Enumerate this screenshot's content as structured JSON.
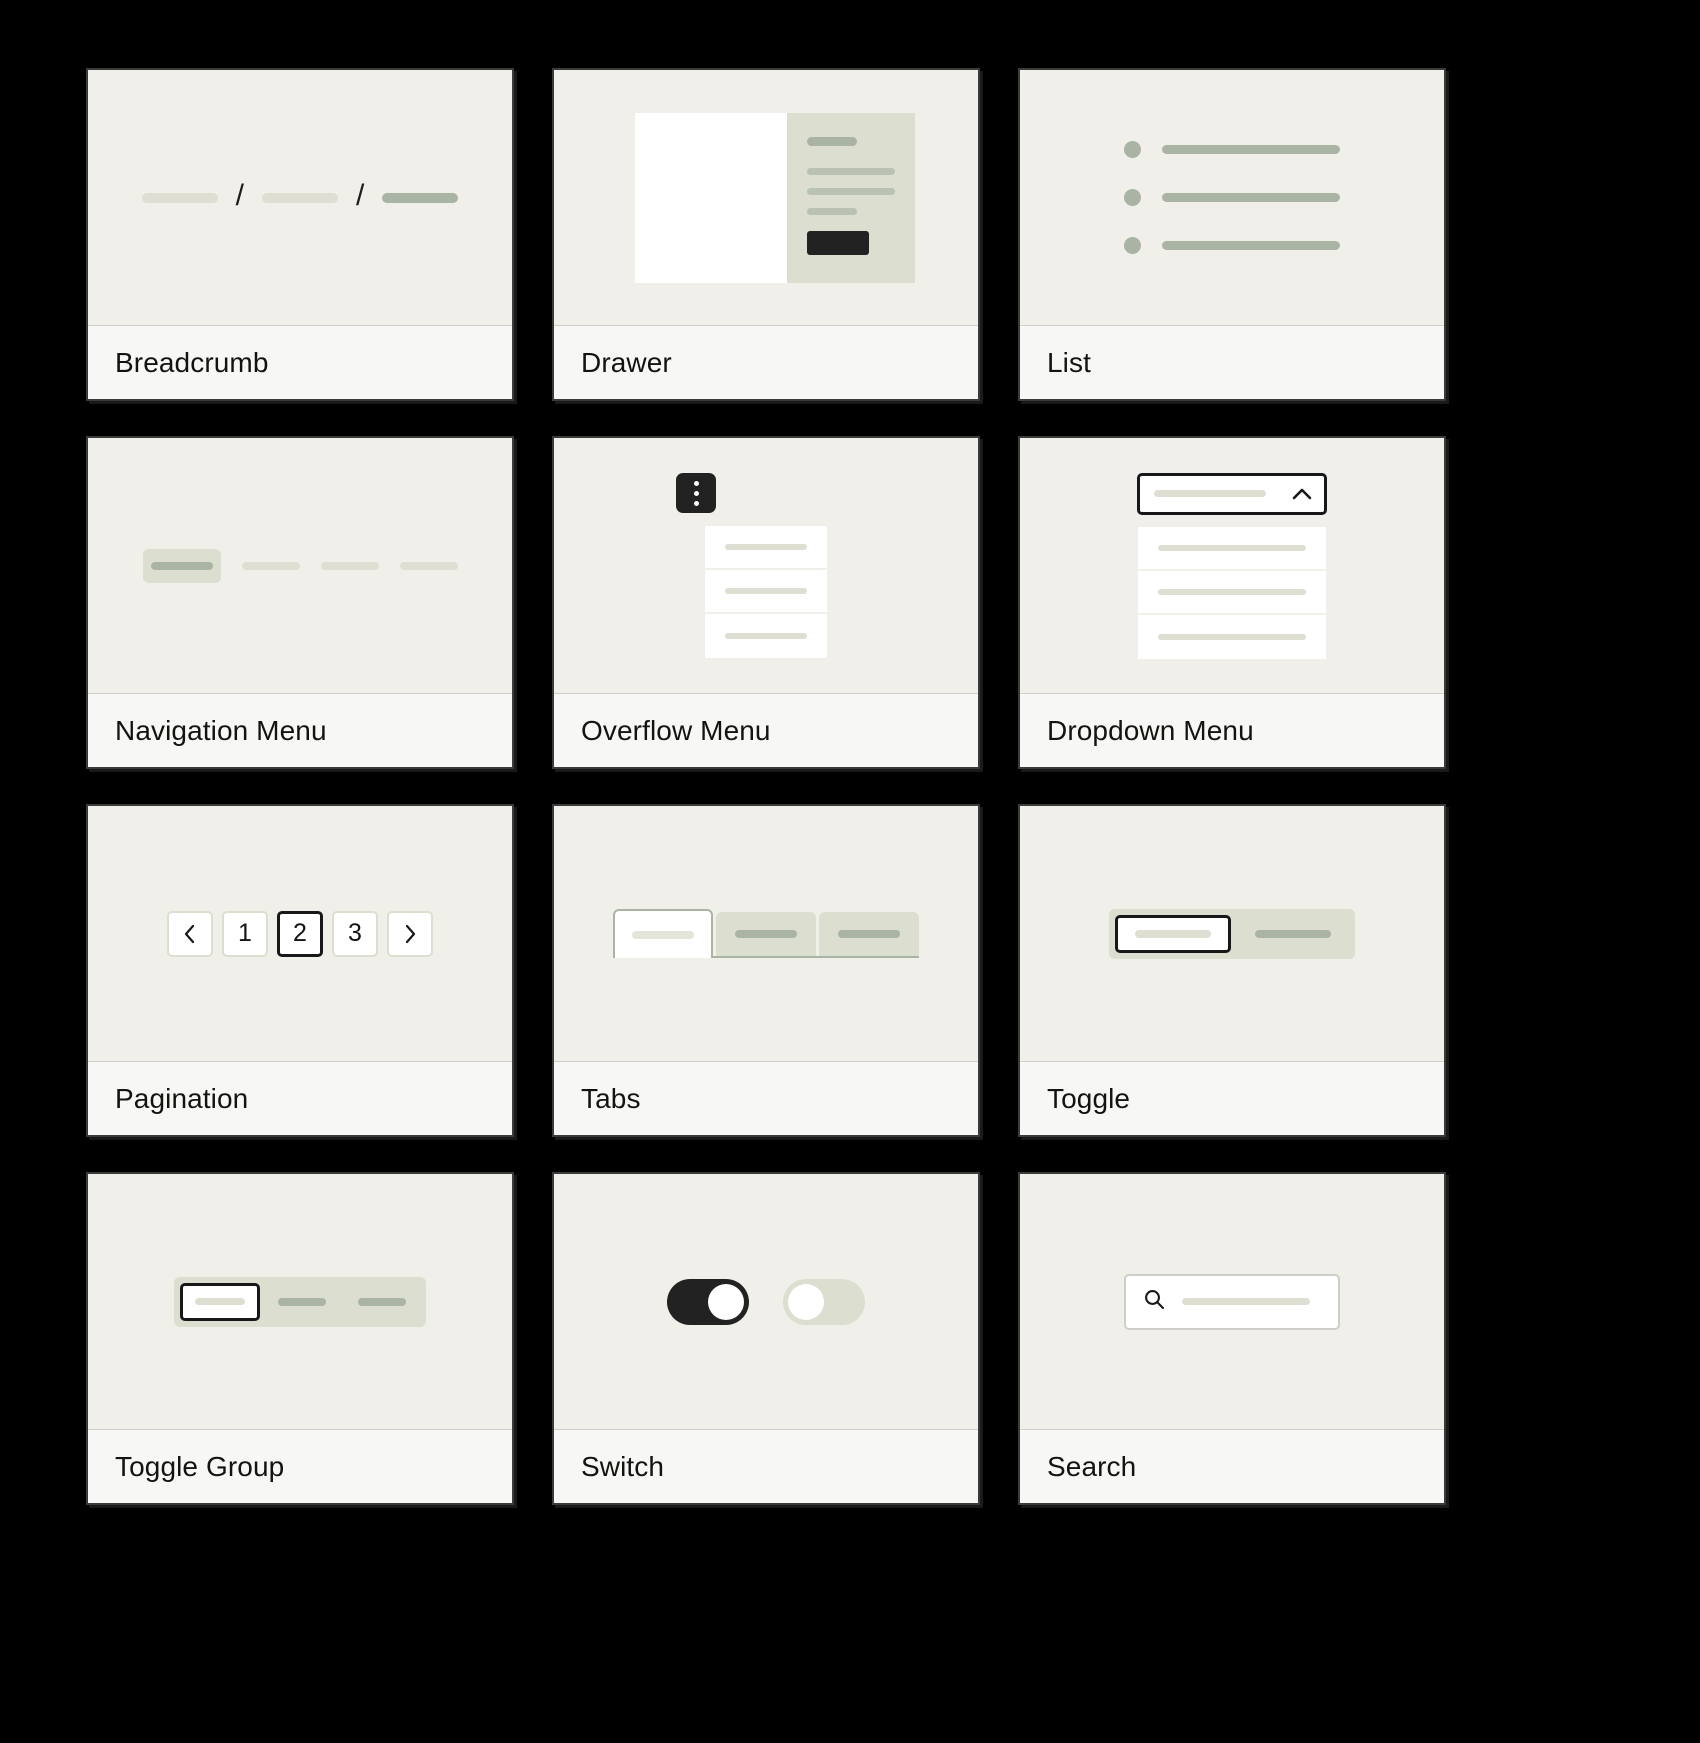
{
  "theme": {
    "background": "#000000",
    "card_canvas": "#f0efe9",
    "card_label_bg": "#f7f7f5",
    "card_border": "#3b3b3b",
    "placeholder_light": "#dedfd2",
    "placeholder_mid": "#c3cbbc",
    "placeholder_dark": "#a9b4a4",
    "surface_white": "#ffffff",
    "accent_dark": "#222222",
    "text": "#14140f"
  },
  "gallery": {
    "columns": 3,
    "rows": 4,
    "cards": [
      {
        "id": "breadcrumb",
        "label": "Breadcrumb",
        "illustration": "breadcrumb"
      },
      {
        "id": "drawer",
        "label": "Drawer",
        "illustration": "drawer"
      },
      {
        "id": "list",
        "label": "List",
        "illustration": "list"
      },
      {
        "id": "navigation-menu",
        "label": "Navigation Menu",
        "illustration": "navigation-menu"
      },
      {
        "id": "overflow-menu",
        "label": "Overflow Menu",
        "illustration": "overflow-menu"
      },
      {
        "id": "dropdown-menu",
        "label": "Dropdown Menu",
        "illustration": "dropdown-menu"
      },
      {
        "id": "pagination",
        "label": "Pagination",
        "illustration": "pagination"
      },
      {
        "id": "tabs",
        "label": "Tabs",
        "illustration": "tabs"
      },
      {
        "id": "toggle",
        "label": "Toggle",
        "illustration": "toggle"
      },
      {
        "id": "toggle-group",
        "label": "Toggle Group",
        "illustration": "toggle-group"
      },
      {
        "id": "switch",
        "label": "Switch",
        "illustration": "switch"
      },
      {
        "id": "search",
        "label": "Search",
        "illustration": "search"
      }
    ]
  },
  "breadcrumb": {
    "separator": "/",
    "items": [
      {
        "state": "inactive"
      },
      {
        "state": "inactive"
      },
      {
        "state": "current"
      }
    ]
  },
  "drawer": {
    "panel_items": 3,
    "has_title": true,
    "has_action_button": true
  },
  "list": {
    "items": [
      {
        "bullet": true
      },
      {
        "bullet": true
      },
      {
        "bullet": true
      }
    ]
  },
  "navigation_menu": {
    "items": [
      {
        "state": "active"
      },
      {
        "state": "inactive"
      },
      {
        "state": "inactive"
      },
      {
        "state": "inactive"
      }
    ]
  },
  "overflow_menu": {
    "trigger_icon": "kebab-icon",
    "dots": 3,
    "menu_items": 3,
    "open": true
  },
  "dropdown_menu": {
    "chevron_icon": "chevron-up-icon",
    "open": true,
    "menu_items": 3
  },
  "pagination": {
    "prev_icon": "chevron-left-icon",
    "next_icon": "chevron-right-icon",
    "pages": [
      {
        "label": "1",
        "active": false
      },
      {
        "label": "2",
        "active": true
      },
      {
        "label": "3",
        "active": false
      }
    ],
    "current_page": "2"
  },
  "tabs": {
    "items": [
      {
        "state": "active"
      },
      {
        "state": "inactive"
      },
      {
        "state": "inactive"
      }
    ]
  },
  "toggle": {
    "segments": [
      {
        "state": "selected"
      },
      {
        "state": "unselected"
      }
    ]
  },
  "toggle_group": {
    "segments": [
      {
        "state": "selected"
      },
      {
        "state": "unselected"
      },
      {
        "state": "unselected"
      }
    ]
  },
  "switch": {
    "switches": [
      {
        "state": "on"
      },
      {
        "state": "off"
      }
    ]
  },
  "search": {
    "icon": "search-icon",
    "has_query_placeholder": true
  }
}
